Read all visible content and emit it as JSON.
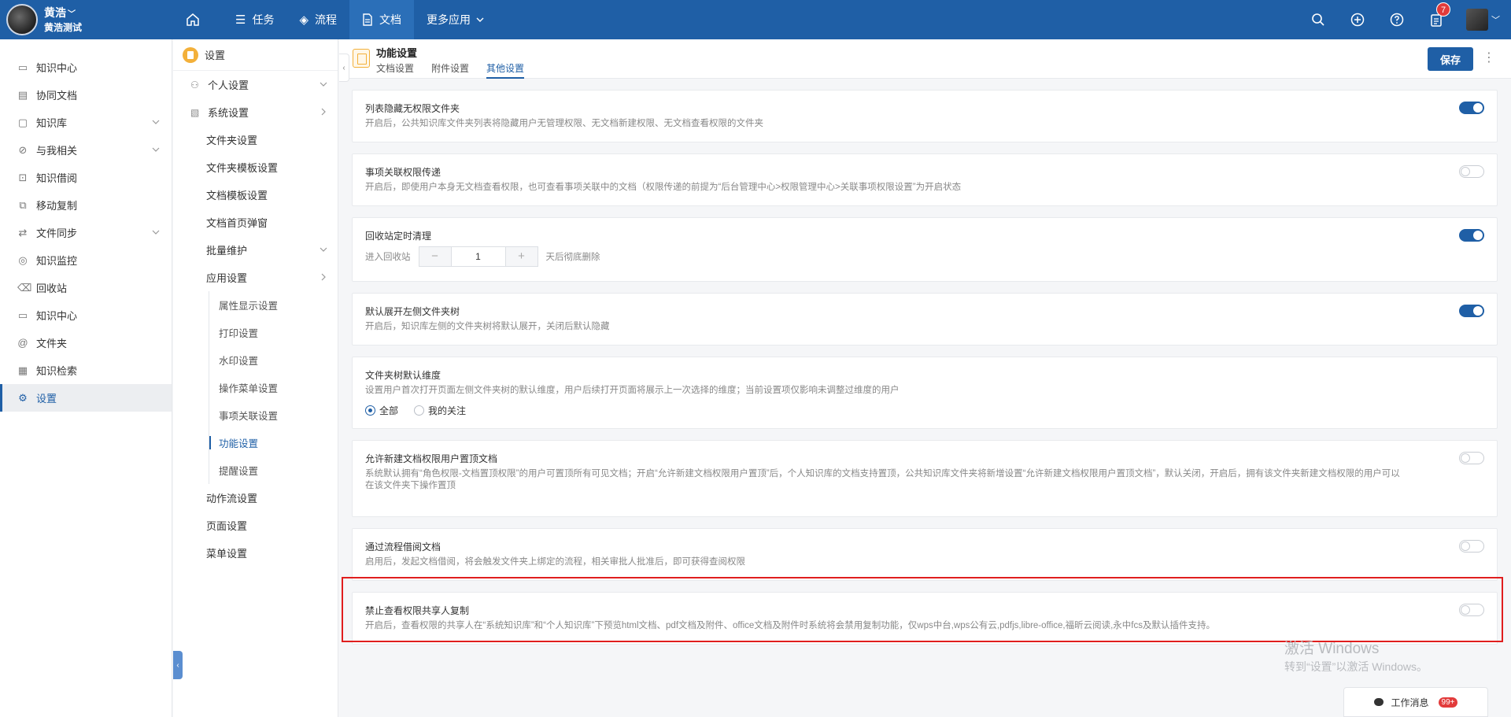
{
  "user": {
    "name": "黄浩",
    "org": "黄浩测试"
  },
  "nav": {
    "items": [
      {
        "label": "任务",
        "icon": "list-icon"
      },
      {
        "label": "流程",
        "icon": "layers-icon"
      },
      {
        "label": "文档",
        "icon": "document-icon"
      },
      {
        "label": "更多应用",
        "icon": "chevron-down-icon"
      }
    ],
    "active": "文档",
    "notifications": "7"
  },
  "sidebar": {
    "items": [
      {
        "label": "知识中心",
        "icon": "file-icon"
      },
      {
        "label": "协同文档",
        "icon": "doc-icon"
      },
      {
        "label": "知识库",
        "icon": "box-icon"
      },
      {
        "label": "与我相关",
        "icon": "user-link-icon"
      },
      {
        "label": "知识借阅",
        "icon": "borrow-icon"
      },
      {
        "label": "移动复制",
        "icon": "copy-icon"
      },
      {
        "label": "文件同步",
        "icon": "sync-icon"
      },
      {
        "label": "知识监控",
        "icon": "monitor-icon"
      },
      {
        "label": "回收站",
        "icon": "trash-icon"
      },
      {
        "label": "知识中心",
        "icon": "file-icon"
      },
      {
        "label": "文件夹",
        "icon": "at-icon"
      },
      {
        "label": "知识检索",
        "icon": "grid-icon"
      },
      {
        "label": "设置",
        "icon": "settings-icon"
      }
    ]
  },
  "settings_nav": {
    "title": "设置",
    "items": [
      {
        "label": "个人设置"
      },
      {
        "label": "系统设置"
      },
      {
        "label": "文件夹设置"
      },
      {
        "label": "文件夹模板设置"
      },
      {
        "label": "文档模板设置"
      },
      {
        "label": "文档首页弹窗"
      },
      {
        "label": "批量维护"
      },
      {
        "label": "应用设置"
      },
      {
        "label": "属性显示设置"
      },
      {
        "label": "打印设置"
      },
      {
        "label": "水印设置"
      },
      {
        "label": "操作菜单设置"
      },
      {
        "label": "事项关联设置"
      },
      {
        "label": "功能设置"
      },
      {
        "label": "提醒设置"
      },
      {
        "label": "动作流设置"
      },
      {
        "label": "页面设置"
      },
      {
        "label": "菜单设置"
      }
    ]
  },
  "header": {
    "title": "功能设置",
    "tabs": [
      {
        "label": "文档设置"
      },
      {
        "label": "附件设置"
      },
      {
        "label": "其他设置"
      }
    ],
    "save_label": "保存"
  },
  "settings": [
    {
      "title": "列表隐藏无权限文件夹",
      "desc": "开启后，公共知识库文件夹列表将隐藏用户无管理权限、无文档新建权限、无文档查看权限的文件夹",
      "enabled": true
    },
    {
      "title": "事项关联权限传递",
      "desc": "开启后，即使用户本身无文档查看权限，也可查看事项关联中的文档（权限传递的前提为“后台管理中心>权限管理中心>关联事项权限设置”为开启状态",
      "enabled": false
    },
    {
      "title": "回收站定时清理",
      "prefix": "进入回收站",
      "value": "1",
      "suffix": "天后彻底删除",
      "enabled": true
    },
    {
      "title": "默认展开左侧文件夹树",
      "desc": "开启后，知识库左侧的文件夹树将默认展开，关闭后默认隐藏",
      "enabled": true
    },
    {
      "title": "文件夹树默认维度",
      "desc": "设置用户首次打开页面左侧文件夹树的默认维度，用户后续打开页面将展示上一次选择的维度；当前设置项仅影响未调整过维度的用户",
      "options": [
        "全部",
        "我的关注"
      ],
      "selected": "全部"
    },
    {
      "title": "允许新建文档权限用户置顶文档",
      "desc": "系统默认拥有“角色权限-文档置顶权限”的用户可置顶所有可见文档；开启“允许新建文档权限用户置顶”后，个人知识库的文档支持置顶，公共知识库文件夹将新增设置“允许新建文档权限用户置顶文档”，默认关闭，开启后，拥有该文件夹新建文档权限的用户可以在该文件夹下操作置顶",
      "enabled": false
    },
    {
      "title": "通过流程借阅文档",
      "desc": "启用后，发起文档借阅，将会触发文件夹上绑定的流程，相关审批人批准后，即可获得查阅权限",
      "enabled": false
    },
    {
      "title": "禁止查看权限共享人复制",
      "desc": "开启后，查看权限的共享人在“系统知识库”和“个人知识库”下预览html文档、pdf文档及附件、office文档及附件时系统将会禁用复制功能，仅wps中台,wps公有云,pdfjs,libre-office,福昕云阅读,永中fcs及默认插件支持。",
      "enabled": false
    }
  ],
  "watermark": {
    "line1": "激活 Windows",
    "line2": "转到“设置”以激活 Windows。"
  },
  "work_msg": {
    "label": "工作消息",
    "count": "99+"
  },
  "colors": {
    "primary": "#1f5fa6",
    "highlight": "#e01e1e",
    "badge": "#e23b3b"
  }
}
